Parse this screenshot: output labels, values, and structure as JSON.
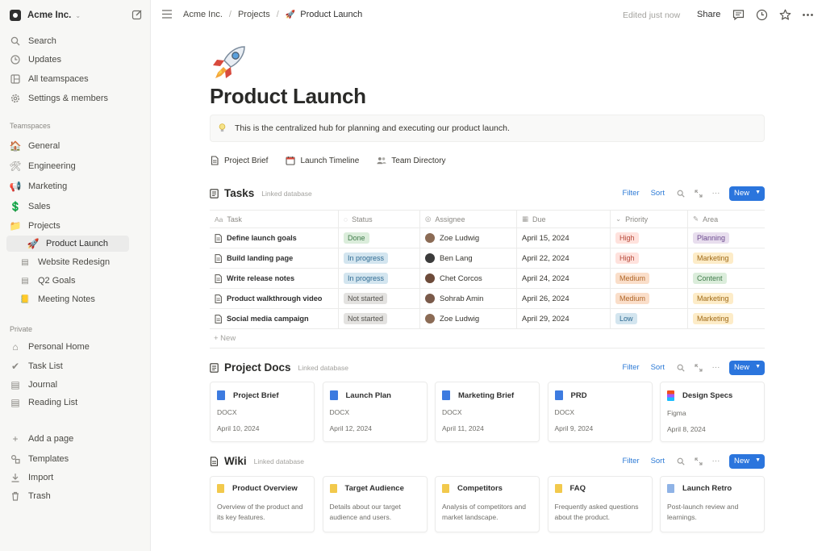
{
  "workspace": {
    "name": "Acme Inc.",
    "chevron": "⌄"
  },
  "sidebar": {
    "top_items": [
      {
        "label": "Search",
        "icon": "search-icon"
      },
      {
        "label": "Updates",
        "icon": "clock-icon"
      },
      {
        "label": "All teamspaces",
        "icon": "grid-icon"
      },
      {
        "label": "Settings & members",
        "icon": "gear-icon"
      }
    ],
    "teamspaces_heading": "Teamspaces",
    "teamspaces": [
      {
        "label": "General",
        "emoji": "🏠"
      },
      {
        "label": "Engineering",
        "emoji": "🛠"
      },
      {
        "label": "Marketing",
        "emoji": "📢"
      },
      {
        "label": "Sales",
        "emoji": "💲"
      },
      {
        "label": "Projects",
        "emoji": "📁"
      }
    ],
    "project_pages": [
      {
        "label": "Product Launch",
        "emoji": "🚀"
      },
      {
        "label": "Website Redesign",
        "emoji": "▤"
      },
      {
        "label": "Q2 Goals",
        "emoji": "▤"
      },
      {
        "label": "Meeting Notes",
        "emoji": "📒"
      }
    ],
    "private_heading": "Private",
    "private": [
      {
        "label": "Personal Home",
        "emoji": "⌂"
      },
      {
        "label": "Task List",
        "emoji": "✔"
      },
      {
        "label": "Journal",
        "emoji": "▤"
      },
      {
        "label": "Reading List",
        "emoji": "▤"
      }
    ],
    "bottom_items": [
      {
        "label": "Add a page",
        "icon": "plus-icon"
      },
      {
        "label": "Templates",
        "icon": "template-icon"
      },
      {
        "label": "Import",
        "icon": "import-icon"
      },
      {
        "label": "Trash",
        "icon": "trash-icon"
      }
    ]
  },
  "topbar": {
    "breadcrumbs": [
      "Acme Inc.",
      "Projects",
      "Product Launch"
    ],
    "breadcrumb_emoji": "🚀",
    "edited": "Edited just now",
    "share": "Share"
  },
  "page": {
    "title": "Product Launch",
    "callout": "This is the centralized hub for planning and executing our product launch.",
    "links": [
      "Project Brief",
      "Launch Timeline",
      "Team Directory"
    ]
  },
  "tasks": {
    "title": "Tasks",
    "linked": "Linked database",
    "filter": "Filter",
    "sort": "Sort",
    "new": "New",
    "columns": [
      "Task",
      "Status",
      "Assignee",
      "Due",
      "Priority",
      "Area"
    ],
    "rows": [
      {
        "task": "Define launch goals",
        "status": "Done",
        "assignee": "Zoe Ludwig",
        "due": "April 15, 2024",
        "priority": "High",
        "area": "Planning"
      },
      {
        "task": "Build landing page",
        "status": "In progress",
        "assignee": "Ben Lang",
        "due": "April 22, 2024",
        "priority": "High",
        "area": "Marketing"
      },
      {
        "task": "Write release notes",
        "status": "In progress",
        "assignee": "Chet Corcos",
        "due": "April 24, 2024",
        "priority": "Medium",
        "area": "Content"
      },
      {
        "task": "Product walkthrough video",
        "status": "Not started",
        "assignee": "Sohrab Amin",
        "due": "April 26, 2024",
        "priority": "Medium",
        "area": "Marketing"
      },
      {
        "task": "Social media campaign",
        "status": "Not started",
        "assignee": "Zoe Ludwig",
        "due": "April 29, 2024",
        "priority": "Low",
        "area": "Marketing"
      }
    ],
    "new_row": "+ New"
  },
  "docs": {
    "title": "Project Docs",
    "linked": "Linked database",
    "filter": "Filter",
    "sort": "Sort",
    "new": "New",
    "cards": [
      {
        "title": "Project Brief",
        "type": "DOCX",
        "date": "April 10, 2024"
      },
      {
        "title": "Launch Plan",
        "type": "DOCX",
        "date": "April 12, 2024"
      },
      {
        "title": "Marketing Brief",
        "type": "DOCX",
        "date": "April 11, 2024"
      },
      {
        "title": "PRD",
        "type": "DOCX",
        "date": "April 9, 2024"
      },
      {
        "title": "Design Specs",
        "type": "Figma",
        "date": "April 8, 2024"
      }
    ]
  },
  "wiki": {
    "title": "Wiki",
    "linked": "Linked database",
    "filter": "Filter",
    "sort": "Sort",
    "new": "New",
    "cards": [
      {
        "title": "Product Overview",
        "desc": "Overview of the product and its key features."
      },
      {
        "title": "Target Audience",
        "desc": "Details about our target audience and users."
      },
      {
        "title": "Competitors",
        "desc": "Analysis of competitors and market landscape."
      },
      {
        "title": "FAQ",
        "desc": "Frequently asked questions about the product."
      },
      {
        "title": "Launch Retro",
        "desc": "Post-launch review and learnings."
      }
    ]
  },
  "colors": {
    "accent": "#2b75dd",
    "sidebar_bg": "#f7f7f5"
  }
}
